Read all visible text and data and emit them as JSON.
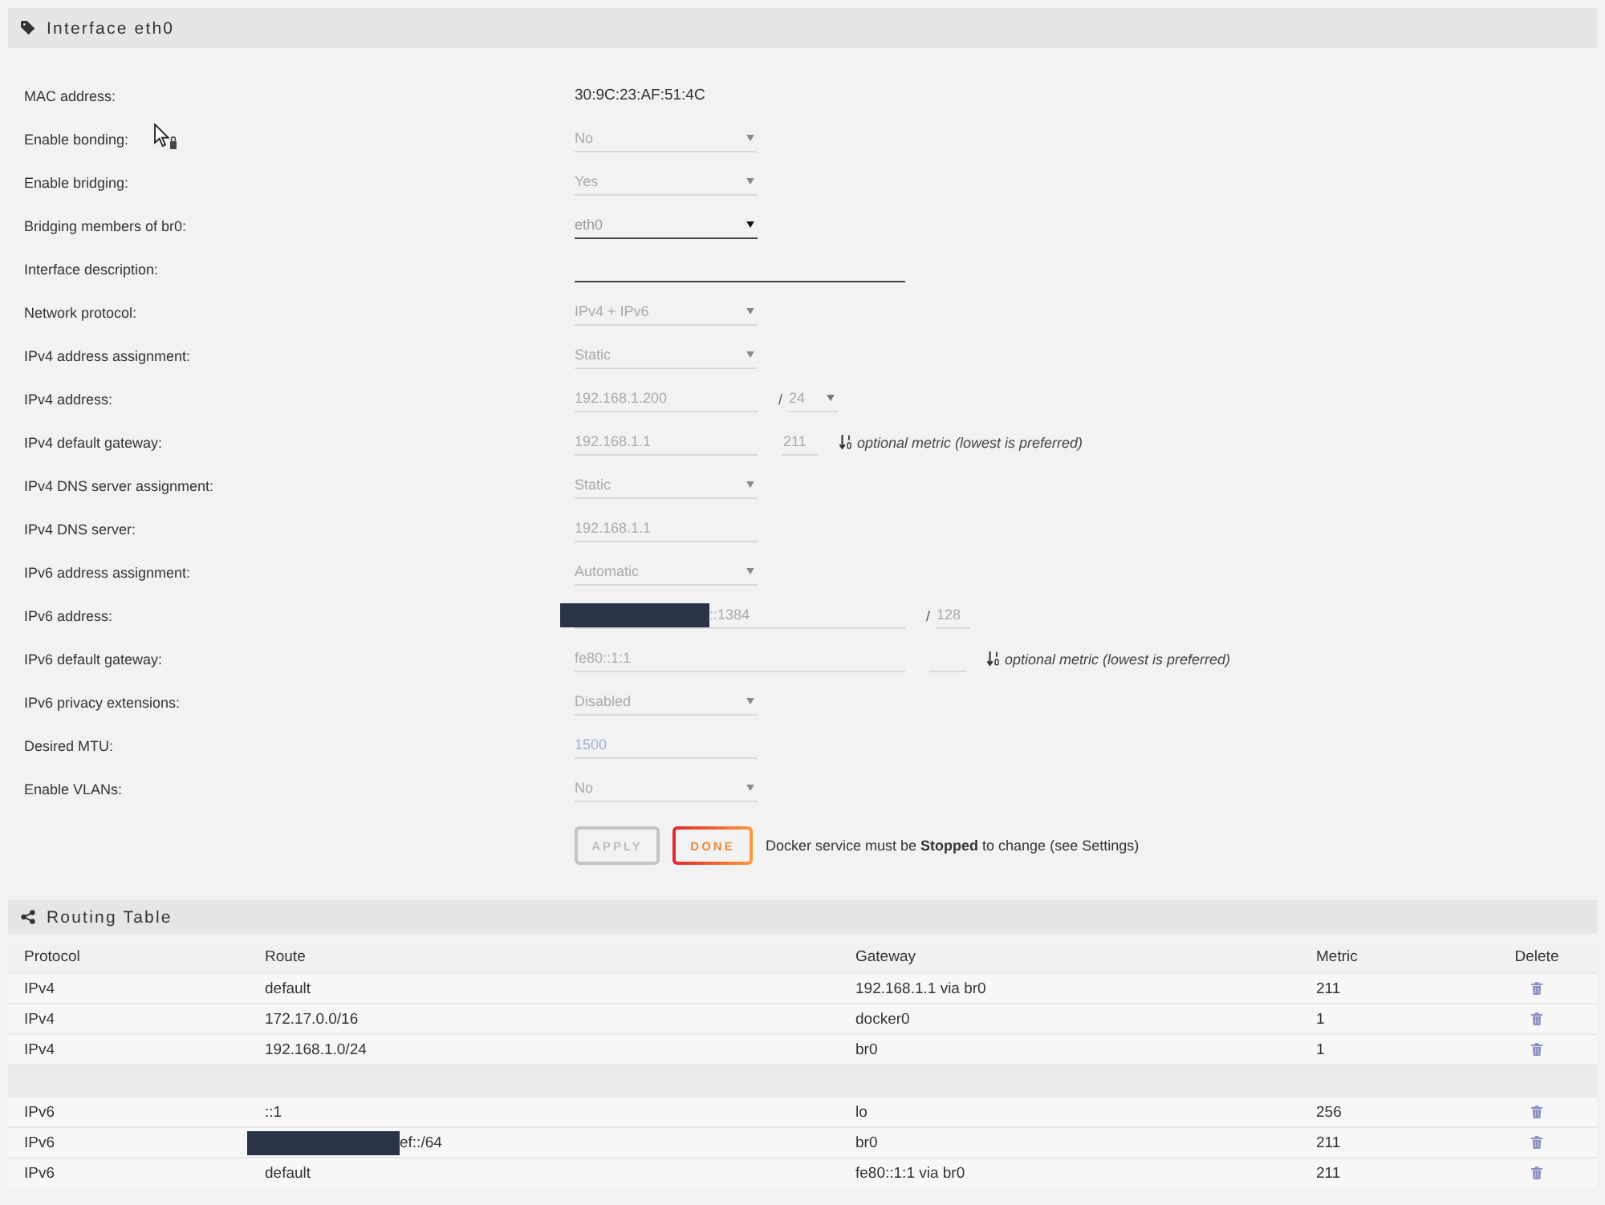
{
  "interface_panel": {
    "title": "Interface eth0",
    "fields": [
      {
        "label": "MAC address:",
        "kind": "static",
        "value": "30:9C:23:AF:51:4C",
        "disabled": false
      },
      {
        "label": "Enable bonding:",
        "kind": "select",
        "value": "No",
        "disabled": true
      },
      {
        "label": "Enable bridging:",
        "kind": "select",
        "value": "Yes",
        "disabled": true
      },
      {
        "label": "Bridging members of br0:",
        "kind": "select",
        "value": "eth0",
        "disabled": false
      },
      {
        "label": "Interface description:",
        "kind": "input",
        "wide": true,
        "disabled": false
      },
      {
        "label": "Network protocol:",
        "kind": "select",
        "value": "IPv4 + IPv6",
        "disabled": true
      },
      {
        "label": "IPv4 address assignment:",
        "kind": "select",
        "value": "Static",
        "disabled": true
      },
      {
        "label": "IPv4 address:",
        "kind": "input",
        "value": "192.168.1.200",
        "disabled": true,
        "suffix": {
          "kind": "prefix",
          "separator": "/",
          "value": "24",
          "dropdown": true
        }
      },
      {
        "label": "IPv4 default gateway:",
        "kind": "input",
        "value": "192.168.1.1",
        "disabled": true,
        "suffix": {
          "kind": "metric",
          "value": "211",
          "hint": "optional metric (lowest is preferred)"
        }
      },
      {
        "label": "IPv4 DNS server assignment:",
        "kind": "select",
        "value": "Static",
        "disabled": true
      },
      {
        "label": "IPv4 DNS server:",
        "kind": "input",
        "value": "192.168.1.1",
        "disabled": true
      },
      {
        "label": "IPv6 address assignment:",
        "kind": "select",
        "value": "Automatic",
        "disabled": true
      },
      {
        "label": "IPv6 address:",
        "kind": "input",
        "wide": true,
        "value": "::1384",
        "redacted": true,
        "disabled": true,
        "suffix": {
          "kind": "prefix",
          "separator": "/",
          "value": "128",
          "dropdown": false
        }
      },
      {
        "label": "IPv6 default gateway:",
        "kind": "input",
        "wide": true,
        "value": "fe80::1:1",
        "disabled": true,
        "suffix": {
          "kind": "metric",
          "hint": "optional metric (lowest is preferred)"
        }
      },
      {
        "label": "IPv6 privacy extensions:",
        "kind": "select",
        "value": "Disabled",
        "disabled": true
      },
      {
        "label": "Desired MTU:",
        "kind": "input",
        "placeholder": "1500",
        "disabled": true
      },
      {
        "label": "Enable VLANs:",
        "kind": "select",
        "value": "No",
        "disabled": true
      }
    ],
    "buttons": [
      {
        "label": "APPLY",
        "disabled": true
      },
      {
        "label": "DONE",
        "disabled": false
      }
    ],
    "note": "Docker service must be **Stopped** to change (see Settings)"
  },
  "routing_table": {
    "title": "Routing Table",
    "columns": [
      "Protocol",
      "Route",
      "Gateway",
      "Metric",
      "Delete"
    ],
    "rows": [
      {
        "kind": "route",
        "protocol": "IPv4",
        "route": "default",
        "gateway": "192.168.1.1 via br0",
        "metric": "211"
      },
      {
        "kind": "route",
        "protocol": "IPv4",
        "route": "172.17.0.0/16",
        "gateway": "docker0",
        "metric": "1"
      },
      {
        "kind": "route",
        "protocol": "IPv4",
        "route": "192.168.1.0/24",
        "gateway": "br0",
        "metric": "1"
      },
      {
        "kind": "spacer"
      },
      {
        "kind": "route",
        "protocol": "IPv6",
        "route": "::1",
        "gateway": "lo",
        "metric": "256"
      },
      {
        "kind": "route",
        "protocol": "IPv6",
        "route": "ef::/64",
        "redacted": true,
        "gateway": "br0",
        "metric": "211"
      },
      {
        "kind": "route",
        "protocol": "IPv6",
        "route": "default",
        "gateway": "fe80::1:1 via br0",
        "metric": "211"
      }
    ]
  }
}
